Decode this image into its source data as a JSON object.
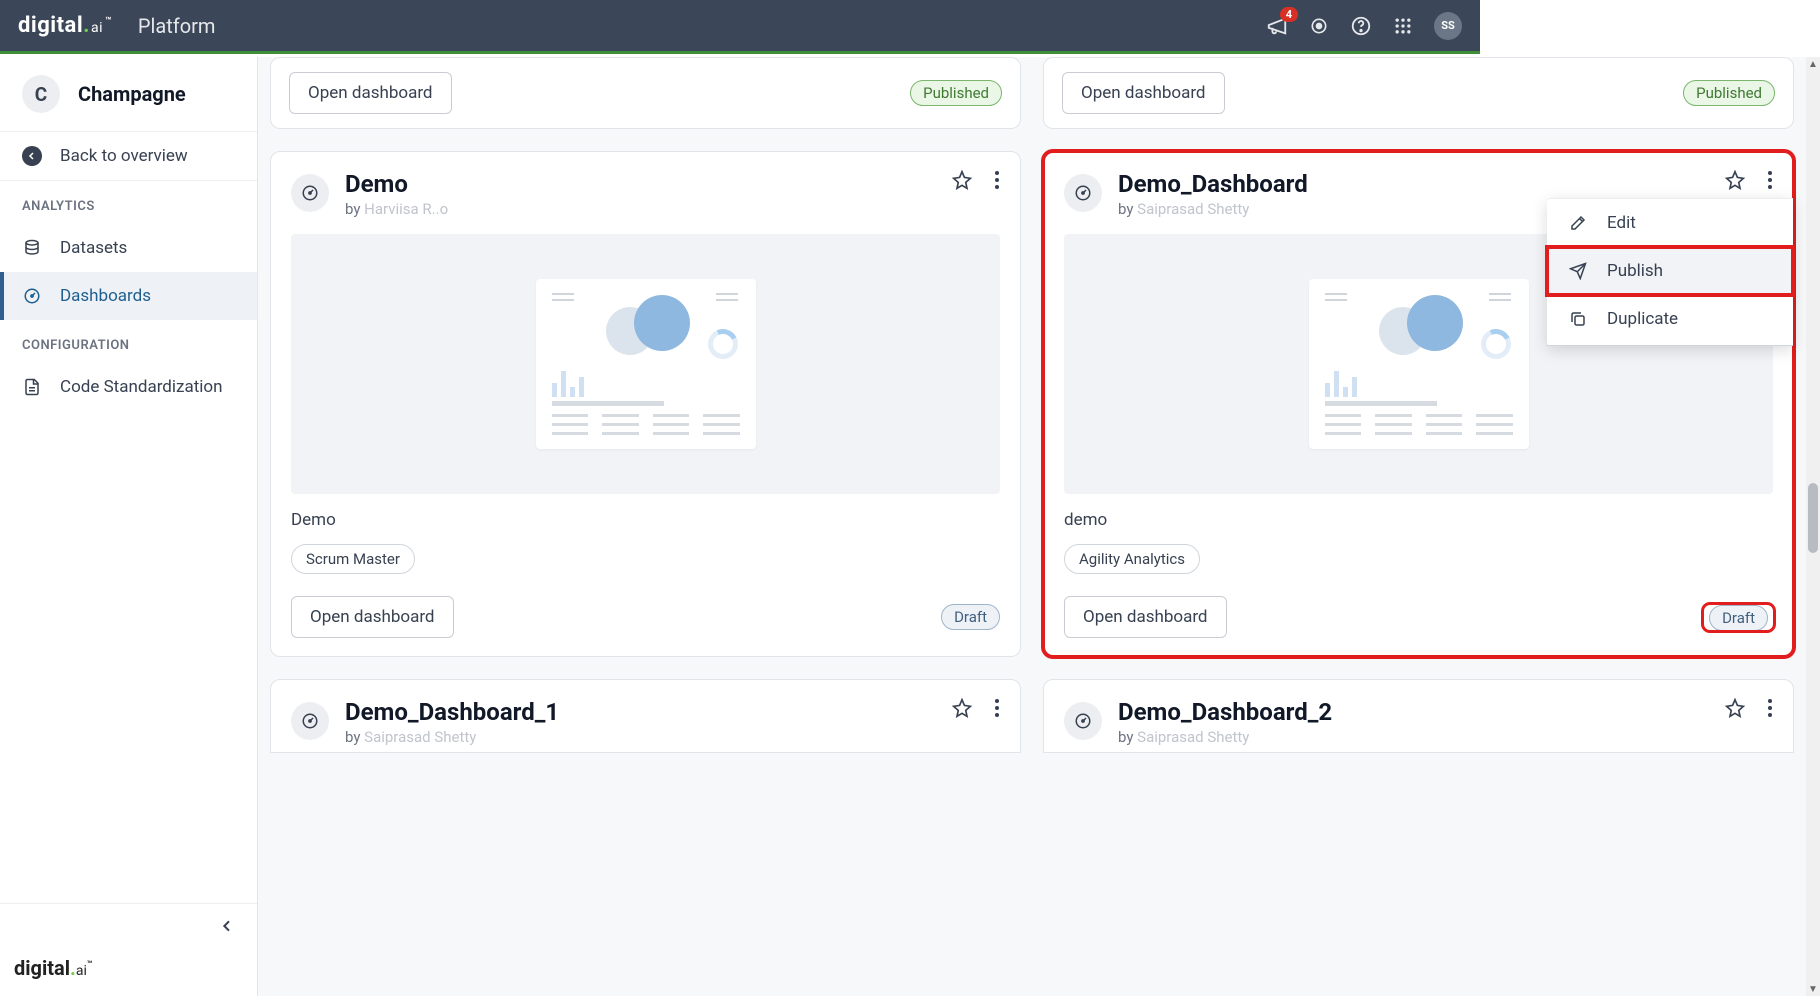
{
  "header": {
    "logo_text": "digital",
    "logo_ai": ".ai",
    "platform": "Platform",
    "notif_count": "4",
    "avatar_initials": "SS"
  },
  "sidebar": {
    "org_initial": "C",
    "org_name": "Champagne",
    "back_label": "Back to overview",
    "section_analytics": "ANALYTICS",
    "item_datasets": "Datasets",
    "item_dashboards": "Dashboards",
    "section_config": "CONFIGURATION",
    "item_codestd": "Code Standardization",
    "footer_logo": "digital.ai"
  },
  "buttons": {
    "open_dashboard": "Open dashboard"
  },
  "status": {
    "published": "Published",
    "draft": "Draft"
  },
  "menu": {
    "edit": "Edit",
    "publish": "Publish",
    "duplicate": "Duplicate"
  },
  "cards": {
    "top": [
      {
        "status": "Published"
      },
      {
        "status": "Published"
      }
    ],
    "middle": [
      {
        "title": "Demo",
        "by_prefix": "by ",
        "author": "Harviisa R..o",
        "desc": "Demo",
        "tag": "Scrum Master",
        "status": "Draft"
      },
      {
        "title": "Demo_Dashboard",
        "by_prefix": "by ",
        "author": "Saiprasad Shetty",
        "desc": "demo",
        "tag": "Agility Analytics",
        "status": "Draft"
      }
    ],
    "bottom": [
      {
        "title": "Demo_Dashboard_1",
        "by_prefix": "by ",
        "author": "Saiprasad Shetty"
      },
      {
        "title": "Demo_Dashboard_2",
        "by_prefix": "by ",
        "author": "Saiprasad Shetty"
      }
    ]
  }
}
